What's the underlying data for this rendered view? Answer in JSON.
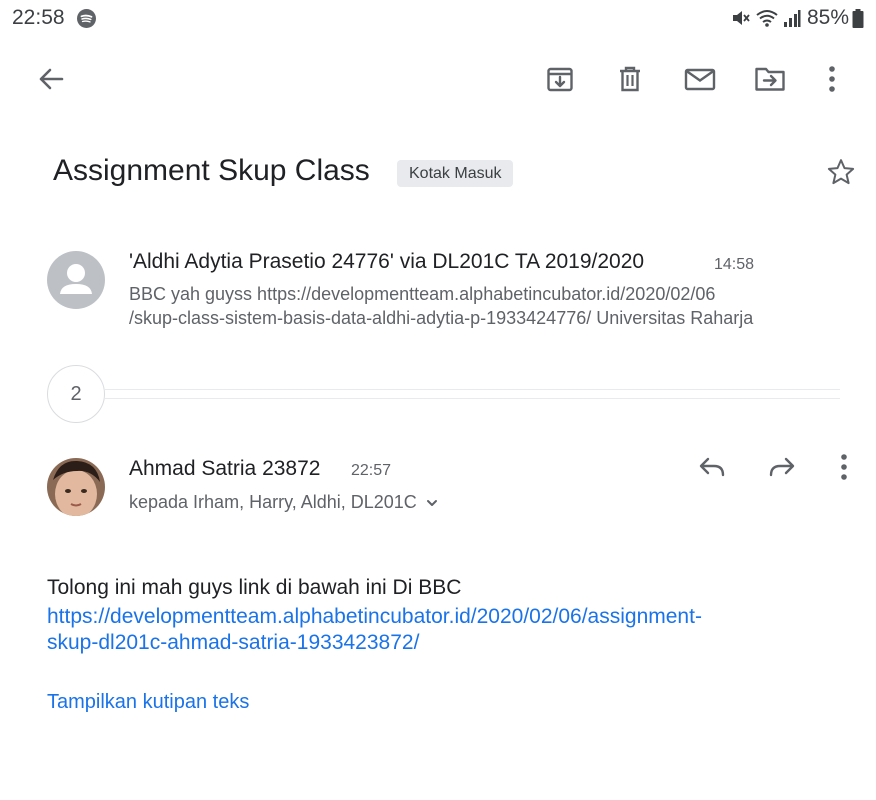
{
  "status_bar": {
    "time": "22:58",
    "battery": "85%",
    "icons": [
      "spotify-icon",
      "mute-icon",
      "wifi-icon",
      "signal-icon",
      "battery-icon"
    ]
  },
  "toolbar": {
    "icons": [
      "back-arrow-icon",
      "archive-icon",
      "delete-icon",
      "mark-unread-icon",
      "move-to-icon",
      "more-vert-icon"
    ]
  },
  "email": {
    "subject": "Assignment Skup Class",
    "label": "Kotak Masuk"
  },
  "messages": [
    {
      "sender": "'Aldhi Adytia Prasetio 24776' via DL201C TA 2019/2020",
      "time": "14:58",
      "snippet_line1": "BBC yah guyss https://developmentteam.alphabetincubator.id/2020/02/06",
      "snippet_line2": "/skup-class-sistem-basis-data-aldhi-adytia-p-1933424776/ Universitas Raharja"
    }
  ],
  "collapsed": {
    "count": "2"
  },
  "open_message": {
    "sender": "Ahmad Satria 23872",
    "time": "22:57",
    "recipients": "kepada Irham, Harry, Aldhi, DL201C",
    "body": "Tolong ini mah guys link di bawah ini Di BBC",
    "link_line1": "https://developmentteam.alphabetincubator.id/2020/02/06/assignment-",
    "link_line2": "skup-dl201c-ahmad-satria-1933423872/",
    "show_quoted": "Tampilkan kutipan teks"
  },
  "colors": {
    "link": "#1a73e8",
    "icon": "#5f6368",
    "chip_bg": "#e8eaed"
  }
}
